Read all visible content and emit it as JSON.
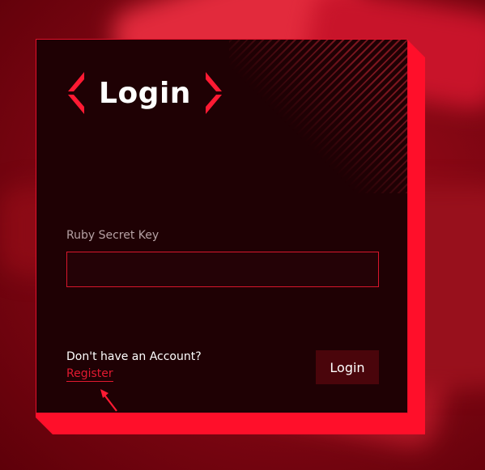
{
  "login_card": {
    "title": "Login",
    "key_label": "Ruby Secret Key",
    "key_value": "",
    "no_account_text": "Don't have an Account?",
    "register_link": "Register",
    "login_button": "Login"
  },
  "colors": {
    "accent": "#ff0f2a",
    "card_background": "#1f0104",
    "button_background": "#4a050b",
    "page_background": "#7a0610"
  },
  "icons": [
    "bracket-left-icon",
    "bracket-right-icon",
    "arrow-pointer-icon"
  ]
}
